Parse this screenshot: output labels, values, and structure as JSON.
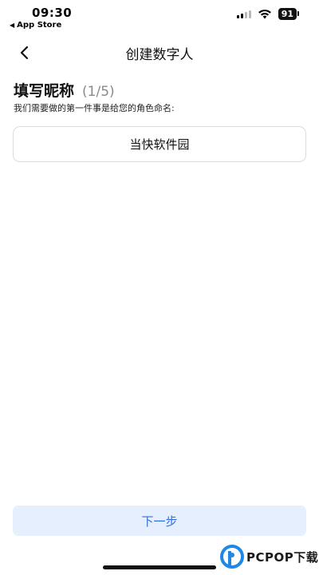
{
  "status_bar": {
    "time": "09:30",
    "back_app": "App Store",
    "battery": "91"
  },
  "nav": {
    "title": "创建数字人"
  },
  "step": {
    "title": "填写昵称",
    "count": "(1/5)",
    "description": "我们需要做的第一件事是给您的角色命名:"
  },
  "name_input": {
    "value": "当快软件园"
  },
  "footer": {
    "next_label": "下一步"
  },
  "watermark": {
    "text": "PCPOP下载"
  }
}
